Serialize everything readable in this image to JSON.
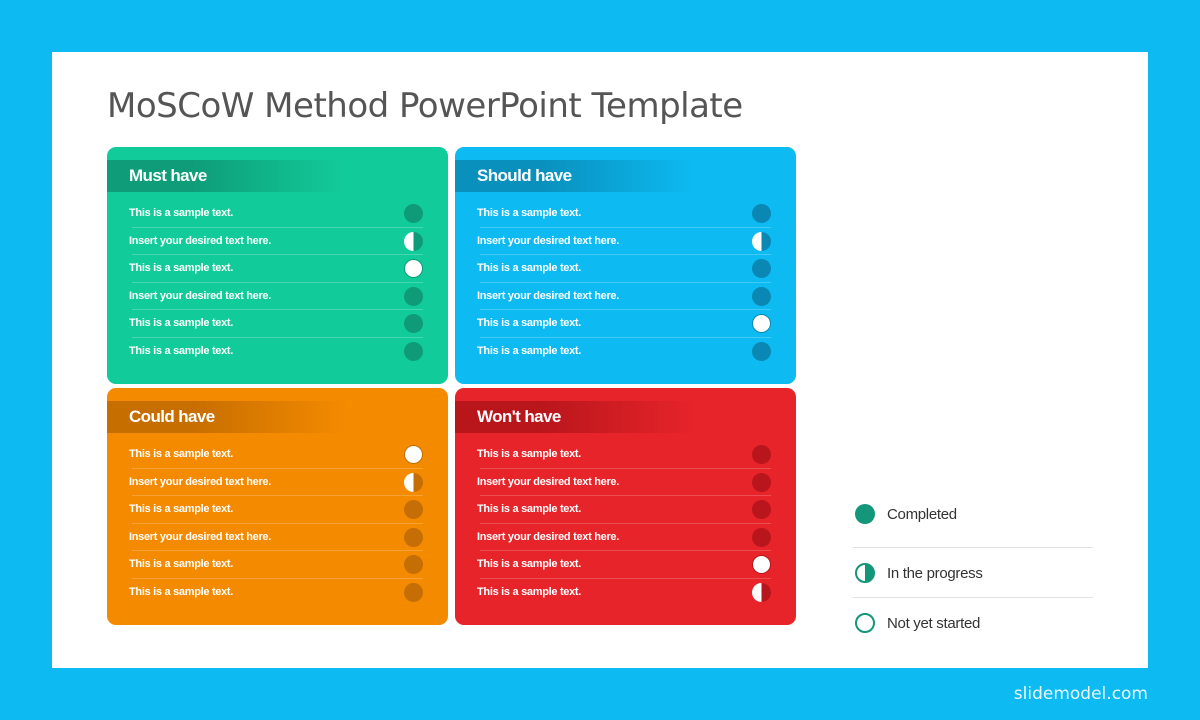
{
  "slide": {
    "title": "MoSCoW Method PowerPoint Template"
  },
  "colors": {
    "page_background": "#0dbaf1",
    "slide_background": "#ffffff",
    "legend_accent": "#13967a"
  },
  "cards": [
    {
      "id": "must",
      "header": "Must have",
      "color": "#12cb9a",
      "header_color": "#0e9d78",
      "dot_color": "#0f9b77",
      "divider_color": "rgba(255,255,255,0.22)",
      "items": [
        {
          "text": "This is a sample text.",
          "status": "completed"
        },
        {
          "text": "Insert your desired text here.",
          "status": "in-progress"
        },
        {
          "text": "This is a sample text.",
          "status": "not-started"
        },
        {
          "text": "Insert your desired text here.",
          "status": "completed"
        },
        {
          "text": "This is a sample text.",
          "status": "completed"
        },
        {
          "text": "This is a sample text.",
          "status": "completed"
        }
      ]
    },
    {
      "id": "should",
      "header": "Should have",
      "color": "#0dbaf1",
      "header_color": "#0990bd",
      "dot_color": "#0a88b3",
      "divider_color": "rgba(255,255,255,0.22)",
      "items": [
        {
          "text": "This is a sample text.",
          "status": "completed"
        },
        {
          "text": "Insert your desired text here.",
          "status": "in-progress"
        },
        {
          "text": "This is a sample text.",
          "status": "completed"
        },
        {
          "text": "Insert your desired text here.",
          "status": "completed"
        },
        {
          "text": "This is a sample text.",
          "status": "not-started"
        },
        {
          "text": "This is a sample text.",
          "status": "completed"
        }
      ]
    },
    {
      "id": "could",
      "header": "Could have",
      "color": "#f48a00",
      "header_color": "#c76e00",
      "dot_color": "#c46e05",
      "divider_color": "rgba(255,255,255,0.2)",
      "items": [
        {
          "text": "This is a sample text.",
          "status": "not-started"
        },
        {
          "text": "Insert your desired text here.",
          "status": "in-progress"
        },
        {
          "text": "This is a sample text.",
          "status": "completed"
        },
        {
          "text": "Insert your desired text here.",
          "status": "completed"
        },
        {
          "text": "This is a sample text.",
          "status": "completed"
        },
        {
          "text": "This is a sample text.",
          "status": "completed"
        }
      ]
    },
    {
      "id": "wont",
      "header": "Won't have",
      "color": "#e6242a",
      "header_color": "#b9161c",
      "dot_color": "#b8161c",
      "divider_color": "rgba(255,255,255,0.2)",
      "items": [
        {
          "text": "This is a sample text.",
          "status": "completed"
        },
        {
          "text": "Insert your desired text here.",
          "status": "completed"
        },
        {
          "text": "This is a sample text.",
          "status": "completed"
        },
        {
          "text": "Insert your desired text here.",
          "status": "completed"
        },
        {
          "text": "This is a sample text.",
          "status": "not-started"
        },
        {
          "text": "This is a sample text.",
          "status": "in-progress"
        }
      ]
    }
  ],
  "legend": [
    {
      "status": "completed",
      "label": "Completed",
      "icon": "filled-circle-icon"
    },
    {
      "status": "in-progress",
      "label": "In the progress",
      "icon": "half-circle-icon"
    },
    {
      "status": "not-started",
      "label": "Not yet started",
      "icon": "empty-circle-icon"
    }
  ],
  "footer": {
    "brand": "slidemodel.com"
  }
}
